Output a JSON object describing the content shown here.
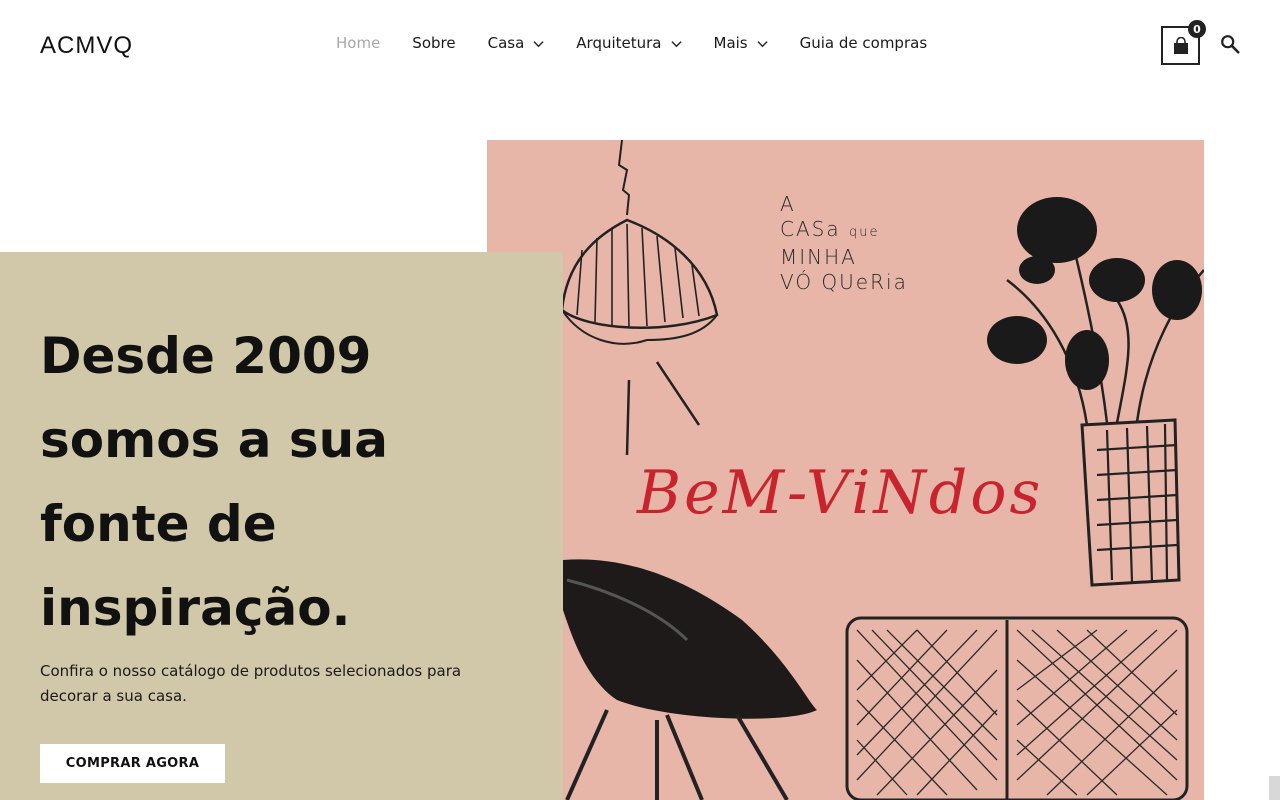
{
  "header": {
    "logo": "ACMVQ",
    "nav": [
      {
        "label": "Home"
      },
      {
        "label": "Sobre"
      },
      {
        "label": "Casa"
      },
      {
        "label": "Arquitetura"
      },
      {
        "label": "Mais"
      },
      {
        "label": "Guia de compras"
      }
    ],
    "cart_count": "0"
  },
  "hero": {
    "headline": "Desde 2009 somos a sua fonte de inspiração.",
    "subtext": "Confira o nosso catálogo de produtos selecionados  para decorar a sua casa.",
    "cta_label": "COMPRAR AGORA",
    "art": {
      "line1": "A",
      "line2a": "CASa",
      "line2b": "que",
      "line3": "MINHA",
      "line4": "VÓ QUeRia",
      "welcome": "BeM-ViNdos"
    }
  },
  "colors": {
    "panel": "#d0c8a8",
    "art_background": "#e8b6a8",
    "welcome_text": "#c8242e",
    "nav_active": "#a9a9a9"
  },
  "icons": {
    "cart": "shopping-bag-icon",
    "search": "search-icon",
    "dropdown": "chevron-down-icon"
  }
}
